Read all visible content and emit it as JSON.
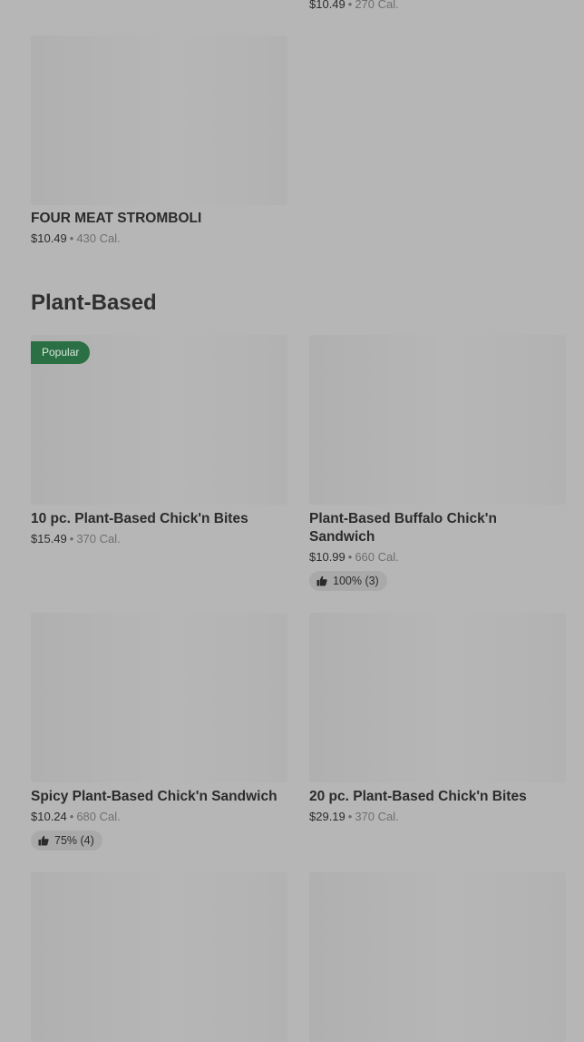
{
  "top_partial": {
    "price": "$10.49",
    "calories": "270 Cal."
  },
  "top_card": {
    "name": "FOUR MEAT STROMBOLI",
    "price": "$10.49",
    "calories": "430 Cal."
  },
  "section": {
    "title": "Plant-Based"
  },
  "items": [
    {
      "name": "10 pc. Plant-Based Chick'n Bites",
      "price": "$15.49",
      "calories": "370 Cal.",
      "badge": "Popular"
    },
    {
      "name": "Plant-Based Buffalo Chick'n Sandwich",
      "price": "$10.99",
      "calories": "660 Cal.",
      "rating": "100% (3)"
    },
    {
      "name": "Spicy Plant-Based Chick'n Sandwich",
      "price": "$10.24",
      "calories": "680 Cal.",
      "rating": "75% (4)"
    },
    {
      "name": "20 pc. Plant-Based Chick'n Bites",
      "price": "$29.19",
      "calories": "370 Cal."
    }
  ],
  "icons": {
    "rating": "thumbs-up-icon"
  },
  "colors": {
    "badge_bg": "#2b6f45",
    "background": "#b6b6b6"
  }
}
